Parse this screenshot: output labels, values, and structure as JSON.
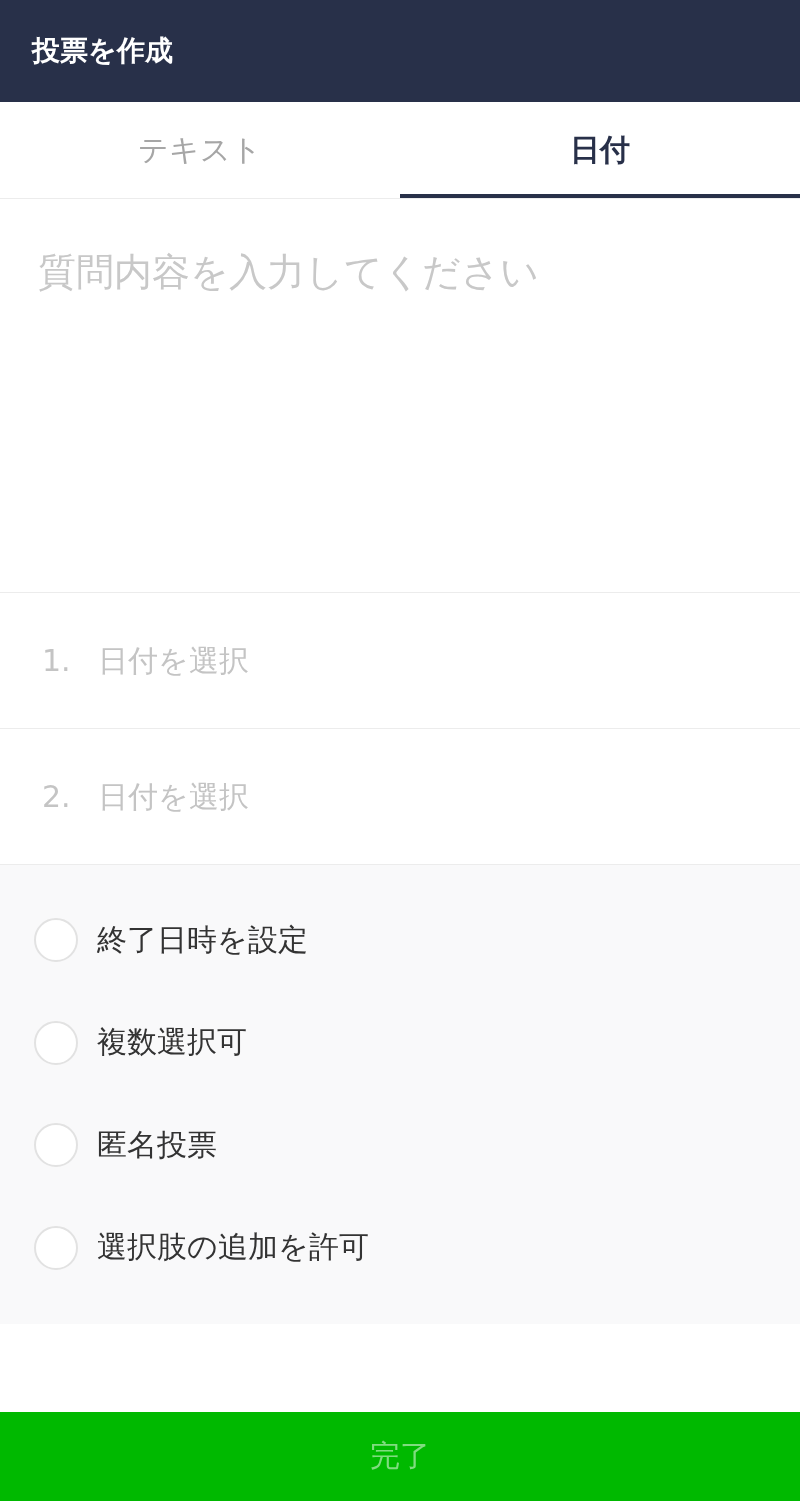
{
  "header": {
    "title": "投票を作成"
  },
  "tabs": [
    {
      "label": "テキスト",
      "selected": false
    },
    {
      "label": "日付",
      "selected": true
    }
  ],
  "question": {
    "placeholder": "質問内容を入力してください"
  },
  "options": [
    {
      "number": "1.",
      "placeholder": "日付を選択"
    },
    {
      "number": "2.",
      "placeholder": "日付を選択"
    }
  ],
  "settings": [
    {
      "label": "終了日時を設定",
      "checked": false
    },
    {
      "label": "複数選択可",
      "checked": false
    },
    {
      "label": "匿名投票",
      "checked": false
    },
    {
      "label": "選択肢の追加を許可",
      "checked": false
    }
  ],
  "done_button": {
    "label": "完了",
    "disabled": true
  }
}
